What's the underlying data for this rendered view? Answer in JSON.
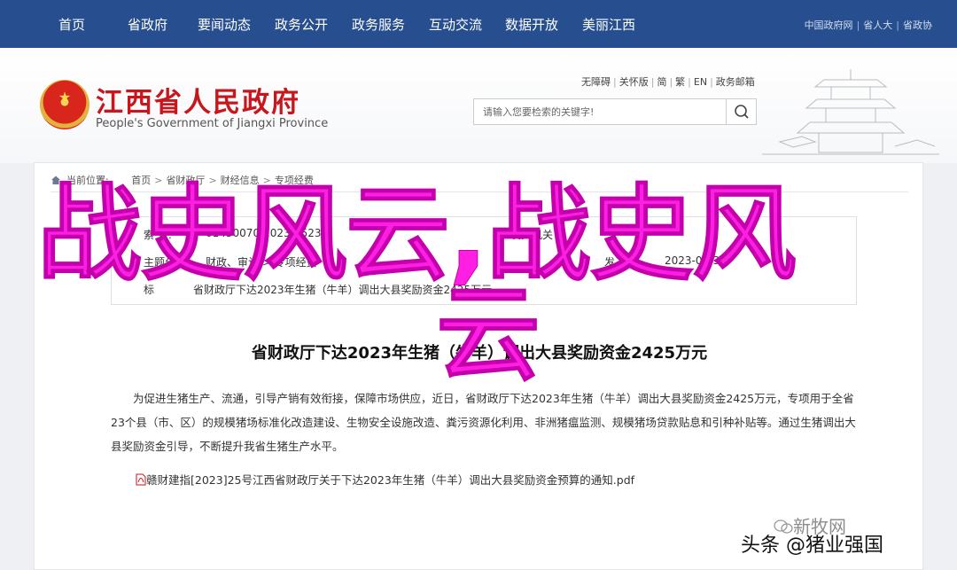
{
  "nav": {
    "items": [
      "首页",
      "省政府",
      "要闻动态",
      "政务公开",
      "政务服务",
      "互动交流",
      "数据开放",
      "美丽江西"
    ],
    "right_links": [
      "中国政府网",
      "省人大",
      "省政协"
    ]
  },
  "header": {
    "title": "江西省人民政府",
    "subtitle": "People's Government of Jiangxi Province",
    "util_links": [
      "无障碍",
      "关怀版",
      "简",
      "繁",
      "EN",
      "政务邮箱"
    ]
  },
  "search": {
    "placeholder": "请输入您要检索的关键字!"
  },
  "breadcrumb": {
    "label": "当前位置:",
    "items": [
      "首页",
      "省财政厅",
      "财经信息",
      "专项经费"
    ]
  },
  "meta": {
    "label_index": "索  号:",
    "value_index": "01450070/2023-0523",
    "label_org_partial": "发文机关",
    "label_topic": "主题分类:",
    "value_topic": "财政、审计 > 专项经费",
    "label_date_partial": "发",
    "value_date": "2023-05-30",
    "label_title_partial": "标",
    "value_title": "省财政厅下达2023年生猪（牛羊）调出大县奖励资金2425万元"
  },
  "article": {
    "title": "省财政厅下达2023年生猪（牛羊）调出大县奖励资金2425万元",
    "body": "为促进生猪生产、流通，引导产销有效衔接，保障市场供应，近日，省财政厅下达2023年生猪（牛羊）调出大县奖励资金2425万元，专项用于全省23个县（市、区）的规模猪场标准化改造建设、生物安全设施改造、粪污资源化利用、非洲猪瘟监测、规模猪场贷款贴息和引种补贴等。通过生猪调出大县奖励资金引导，不断提升我省生猪生产水平。",
    "attachment": "赣财建指[2023]25号江西省财政厅关于下达2023年生猪（牛羊）调出大县奖励资金预算的通知.pdf"
  },
  "overlay": {
    "line1": "战史风云,战史风",
    "line2": "云"
  },
  "watermark": {
    "faint": "新牧网",
    "credit": "头条 @猪业强国"
  },
  "colors": {
    "nav_bg": "#274f8f",
    "title_red": "#c8161d",
    "overlay_magenta": "#ff1fe3"
  },
  "icons": [
    "search-icon",
    "home-icon",
    "pdf-icon",
    "emblem-icon",
    "pagoda-illustration",
    "wechat-icon"
  ]
}
